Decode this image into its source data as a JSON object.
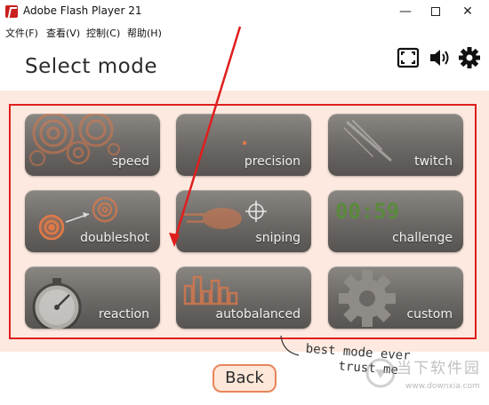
{
  "window": {
    "title": "Adobe Flash Player 21",
    "minimize": "—",
    "close": "✕"
  },
  "menu": [
    "文件(F)",
    "查看(V)",
    "控制(C)",
    "帮助(H)"
  ],
  "header": {
    "title": "Select mode",
    "icons": [
      "fullscreen-icon",
      "speaker-icon",
      "gear-icon"
    ]
  },
  "modes": [
    {
      "label": "speed"
    },
    {
      "label": "precision"
    },
    {
      "label": "twitch"
    },
    {
      "label": "doubleshot"
    },
    {
      "label": "sniping"
    },
    {
      "label": "challenge",
      "clock": "00:59"
    },
    {
      "label": "reaction"
    },
    {
      "label": "autobalanced"
    },
    {
      "label": "custom"
    }
  ],
  "annotation": {
    "line1": "best mode ever",
    "line2": "trust me"
  },
  "back_label": "Back",
  "watermark": {
    "text": "当下软件园",
    "url": "www.downxia.com"
  },
  "colors": {
    "accent": "#e8855a",
    "panel": "#fde9df",
    "highlight": "#e01e1e",
    "tile": "#6b6764"
  }
}
